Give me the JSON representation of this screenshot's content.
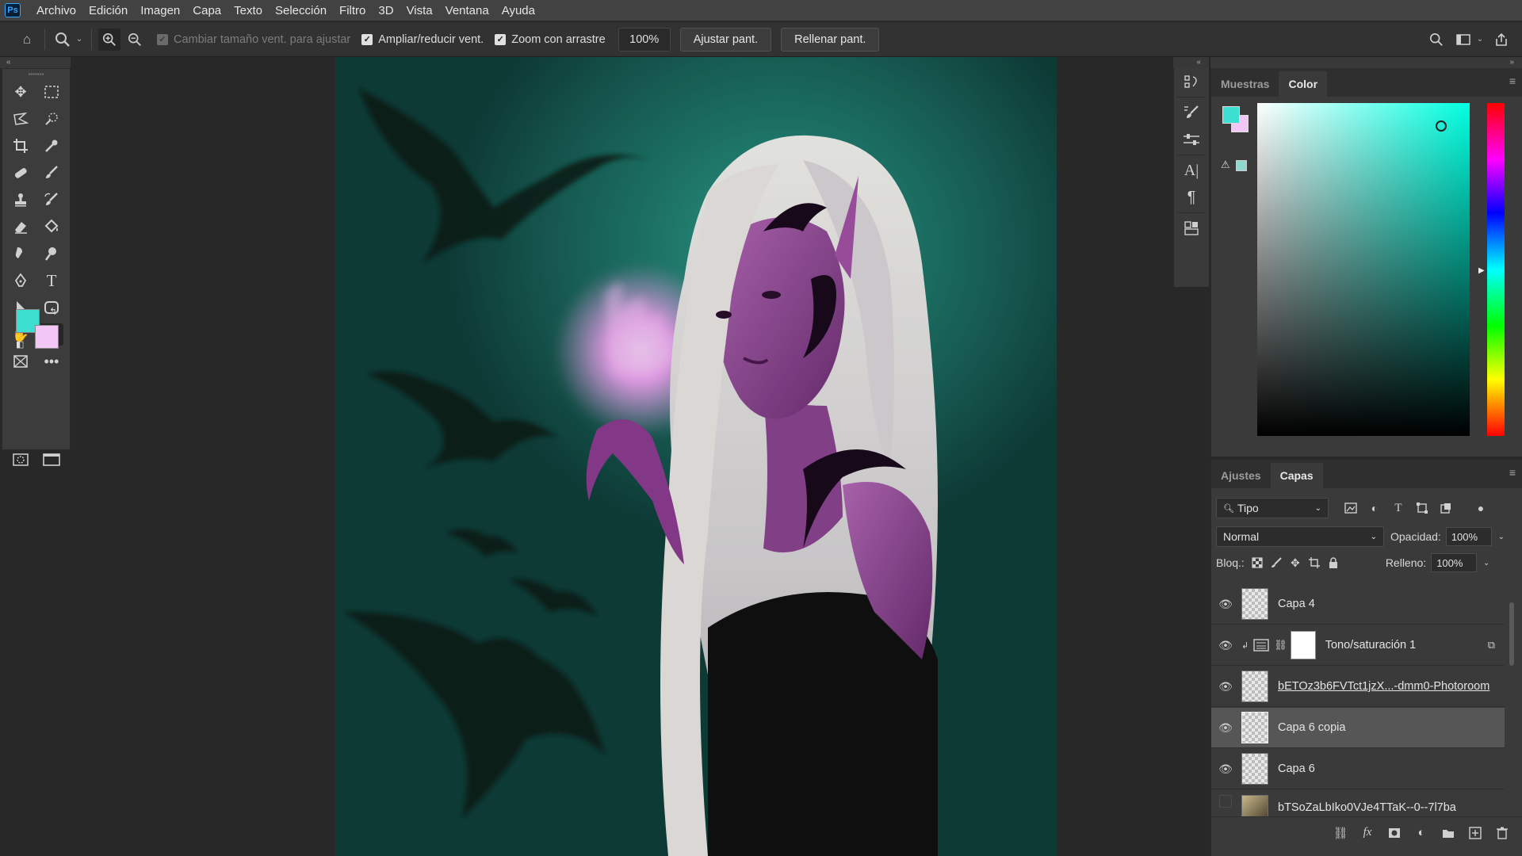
{
  "menubar": {
    "logo": "Ps",
    "items": [
      "Archivo",
      "Edición",
      "Imagen",
      "Capa",
      "Texto",
      "Selección",
      "Filtro",
      "3D",
      "Vista",
      "Ventana",
      "Ayuda"
    ]
  },
  "options_bar": {
    "resize_windows_label": "Cambiar tamaño vent. para ajustar",
    "zoom_all_windows_label": "Ampliar/reducir vent.",
    "scrubby_zoom_label": "Zoom con arrastre",
    "zoom_value": "100%",
    "fit_screen_label": "Ajustar pant.",
    "fill_screen_label": "Rellenar pant."
  },
  "tools": {
    "foreground_color": "#3de0d0",
    "background_color": "#f2c6f5"
  },
  "color_panel": {
    "tabs": [
      "Muestras",
      "Color"
    ],
    "active_tab": "Color"
  },
  "layers_panel": {
    "tabs": [
      "Ajustes",
      "Capas"
    ],
    "active_tab": "Capas",
    "filter_label": "Tipo",
    "blend_mode": "Normal",
    "opacity_label": "Opacidad:",
    "opacity_value": "100%",
    "lock_label": "Bloq.:",
    "fill_label": "Relleno:",
    "fill_value": "100%",
    "layers": [
      {
        "name": "Capa 4",
        "visible": true
      },
      {
        "name": "Tono/saturación 1",
        "visible": true
      },
      {
        "name": "bETOz3b6FVTct1jzX...-dmm0-Photoroom",
        "visible": true
      },
      {
        "name": "Capa 6 copia",
        "visible": true
      },
      {
        "name": "Capa 6",
        "visible": true
      },
      {
        "name": "bTSoZaLbIko0VJe4TTaK--0--7l7ba",
        "visible": false
      }
    ]
  }
}
